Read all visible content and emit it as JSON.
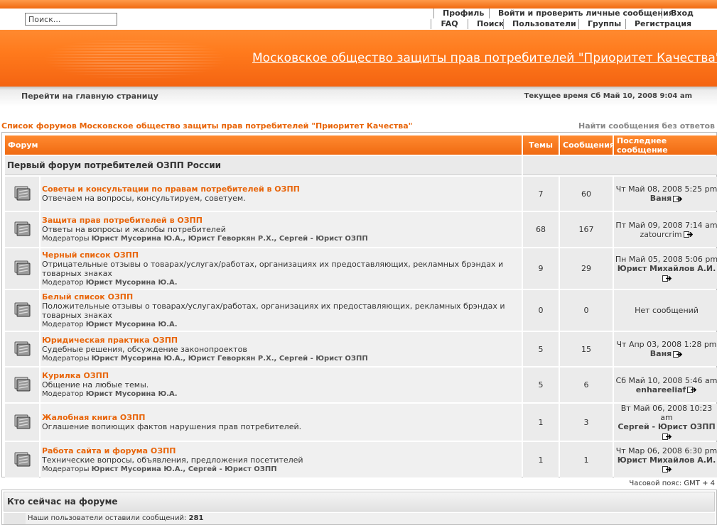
{
  "header": {
    "search_placeholder": "Поиск...",
    "nav_row1": [
      "Профиль",
      "Войти и проверить личные сообщения",
      "Вход"
    ],
    "nav_row2": [
      "FAQ",
      "Поиск",
      "Пользователи",
      "Группы",
      "Регистрация"
    ],
    "site_title": "Московское общество защиты прав потребителей \"Приоритет Качества\"",
    "home_link": "Перейти на главную страницу",
    "current_time": "Текущее время Сб Май 10, 2008 9:04 am"
  },
  "breadcrumb": "Список форумов Московское общество защиты прав потребителей \"Приоритет Качества\"",
  "unanswered_link": "Найти сообщения без ответов",
  "table": {
    "headers": [
      "Форум",
      "Темы",
      "Сообщения",
      "Последнее сообщение"
    ],
    "category": "Первый форум потребителей ОЗПП России",
    "forums": [
      {
        "title": "Советы и консультации по правам потребителей в ОЗПП",
        "desc": "Отвечаем на вопросы, консультируем, советуем.",
        "mod_label": "",
        "mods": "",
        "topics": "7",
        "posts": "60",
        "last_date": "Чт Май 08, 2008 5:25 pm",
        "last_user": "Ваня",
        "last_bold": true
      },
      {
        "title": "Защита прав потребителей в ОЗПП",
        "desc": "Ответы на вопросы и жалобы потребителей",
        "mod_label": "Модераторы",
        "mods": "Юрист Мусорина Ю.А., Юрист Геворкян Р.Х., Сергей - Юрист ОЗПП",
        "topics": "68",
        "posts": "167",
        "last_date": "Пт Май 09, 2008 7:14 am",
        "last_user": "zatourcrim",
        "last_bold": false
      },
      {
        "title": "Черный список ОЗПП",
        "desc": "Отрицательные отзывы о товарах/услугах/работах, организациях их предоставляющих, рекламных брэндах и товарных знаках",
        "mod_label": "Модератор",
        "mods": "Юрист Мусорина Ю.А.",
        "topics": "9",
        "posts": "29",
        "last_date": "Пн Май 05, 2008 5:06 pm",
        "last_user": "Юрист Михайлов А.И.",
        "last_bold": true
      },
      {
        "title": "Белый список ОЗПП",
        "desc": "Положительные отзывы о товарах/услугах/работах, организациях их предоставляющих, рекламных брэндах и товарных знаках",
        "mod_label": "Модератор",
        "mods": "Юрист Мусорина Ю.А.",
        "topics": "0",
        "posts": "0",
        "last_date": "Нет сообщений",
        "last_user": "",
        "last_bold": false
      },
      {
        "title": "Юридическая практика ОЗПП",
        "desc": "Судебные решения, обсуждение законопроектов",
        "mod_label": "Модераторы",
        "mods": "Юрист Мусорина Ю.А., Юрист Геворкян Р.Х., Сергей - Юрист ОЗПП",
        "topics": "5",
        "posts": "15",
        "last_date": "Чт Апр 03, 2008 1:28 pm",
        "last_user": "Ваня",
        "last_bold": true
      },
      {
        "title": "Курилка ОЗПП",
        "desc": "Общение на любые темы.",
        "mod_label": "Модератор",
        "mods": "Юрист Мусорина Ю.А.",
        "topics": "5",
        "posts": "6",
        "last_date": "Сб Май 10, 2008 5:46 am",
        "last_user": "enhareeliaf",
        "last_bold": true
      },
      {
        "title": "Жалобная книга ОЗПП",
        "desc": "Оглашение вопиющих фактов нарушения прав потребителей.",
        "mod_label": "",
        "mods": "",
        "topics": "1",
        "posts": "3",
        "last_date": "Вт Май 06, 2008 10:23 am",
        "last_user": "Сергей - Юрист ОЗПП",
        "last_bold": true
      },
      {
        "title": "Работа сайта и форума ОЗПП",
        "desc": "Технические вопросы, объявления, предложения посетителей",
        "mod_label": "Модераторы",
        "mods": "Юрист Мусорина Ю.А., Сергей - Юрист ОЗПП",
        "topics": "1",
        "posts": "1",
        "last_date": "Чт Мар 06, 2008 6:30 pm",
        "last_user": "Юрист Михайлов А.И.",
        "last_bold": true
      }
    ]
  },
  "timezone": "Часовой пояс: GMT + 4",
  "online": {
    "title": "Кто сейчас на форуме",
    "posts_text": "Наши пользователи оставили сообщений:",
    "posts_count": "281"
  },
  "colors": {
    "accent": "#f06a12",
    "link": "#e8650a"
  },
  "icons": {
    "forum": "folder-icon",
    "goto": "goto-last-post-icon"
  }
}
